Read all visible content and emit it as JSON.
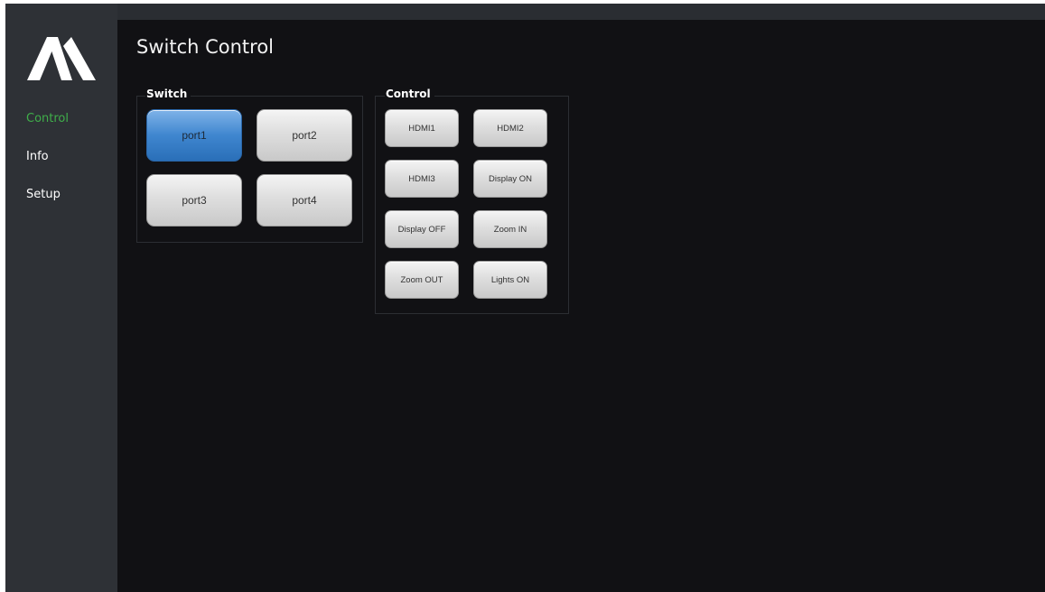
{
  "sidebar": {
    "logo_icon": "stylized-m-logo",
    "items": [
      {
        "label": "Control",
        "active": true
      },
      {
        "label": "Info",
        "active": false
      },
      {
        "label": "Setup",
        "active": false
      }
    ]
  },
  "main": {
    "title": "Switch Control",
    "switch_group": {
      "label": "Switch",
      "ports": [
        {
          "label": "port1",
          "selected": true
        },
        {
          "label": "port2",
          "selected": false
        },
        {
          "label": "port3",
          "selected": false
        },
        {
          "label": "port4",
          "selected": false
        }
      ]
    },
    "control_group": {
      "label": "Control",
      "buttons": [
        "HDMI1",
        "HDMI2",
        "HDMI3",
        "Display ON",
        "Display OFF",
        "Zoom IN",
        "Zoom OUT",
        "Lights ON"
      ]
    }
  },
  "colors": {
    "active_nav": "#3fae4a",
    "selected_button": "#3f86cf",
    "background": "#111114",
    "sidebar": "#2e3136"
  }
}
